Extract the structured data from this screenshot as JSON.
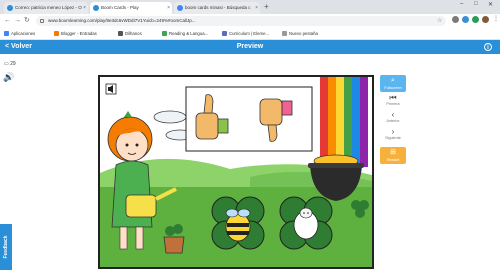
{
  "browser": {
    "tabs": [
      {
        "title": "Correo: patricia meneo López - O"
      },
      {
        "title": "Boom Cards - Play"
      },
      {
        "title": "boom cards minasi - Búsqueda c"
      }
    ],
    "new_tab": "+",
    "url": "www.boomlearning.com/play/8e3dc6vWDdI7V1Yuicb=249%#oomCallJp...",
    "bookmarks": [
      "Aplicaciones",
      "Blogger - Entradas",
      "Dilhanos",
      "Reading & Langua...",
      "Curriculum | Eleme...",
      "Nuevo pestaña"
    ],
    "colors": {
      "tab_bar": "#dee1e6",
      "accent": "#2a8fd6"
    }
  },
  "app": {
    "back_label": "Volver",
    "title": "Preview",
    "info_icon": "info-icon",
    "counter": "29",
    "feedback_label": "Feedback"
  },
  "sidebar": {
    "fullscreen_label": "Fullscreen",
    "first_label": "Primera",
    "prev_label": "Anterior",
    "next_label": "Siguiente",
    "restart_label": "Restart",
    "colors": {
      "fullscreen": "#5bb6f0",
      "restart": "#f6b13c"
    }
  },
  "card": {
    "icons": [
      "speaker-icon",
      "thumbs-up-icon",
      "thumbs-down-icon",
      "girl-watering-can",
      "rainbow",
      "pot-of-gold",
      "bee-clover",
      "sheep-clover",
      "potted-plant"
    ]
  }
}
